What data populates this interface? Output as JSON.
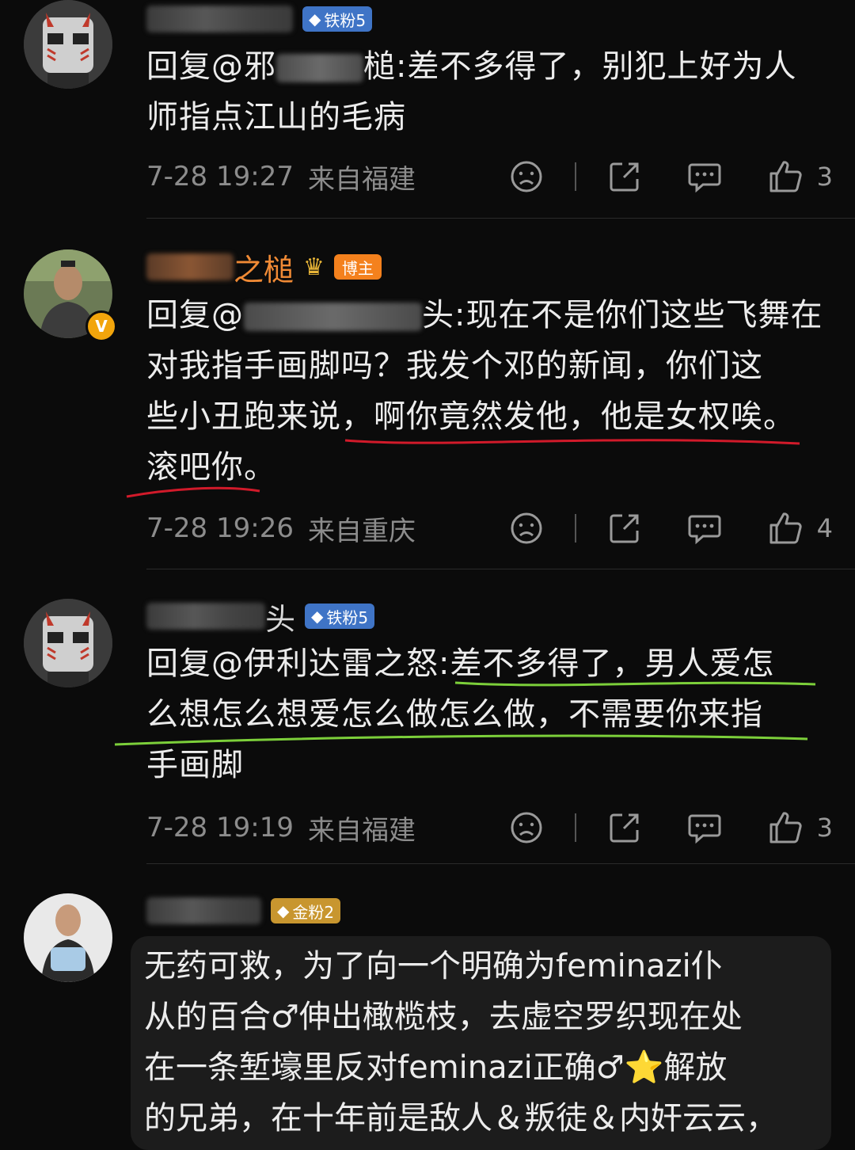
{
  "comments": [
    {
      "badge": "铁粉5",
      "reply_prefix": "回复@邪",
      "reply_rest": "槌:差不多得了，别犯上好为人",
      "line2": "师指点江山的毛病",
      "time": "7-28 19:27",
      "location": "来自福建",
      "likes": "3"
    },
    {
      "name_visible": "之槌",
      "badge": "博主",
      "reply_prefix": "回复@",
      "line1_rest": "头:现在不是你们这些飞舞在",
      "line2": "对我指手画脚吗？我发个邓的新闻，你们这",
      "line3": "些小丑跑来说，啊你竟然发他，他是女权唉。",
      "line4": "滚吧你。",
      "time": "7-28 19:26",
      "location": "来自重庆",
      "likes": "4"
    },
    {
      "name_tail": "头",
      "badge": "铁粉5",
      "line1": "回复@伊利达雷之怒:差不多得了，男人爱怎",
      "line2": "么想怎么想爱怎么做怎么做，不需要你来指",
      "line3": "手画脚",
      "time": "7-28 19:19",
      "location": "来自福建",
      "likes": "3"
    },
    {
      "badge": "金粉2",
      "line1": "无药可救，为了向一个明确为feminazi仆",
      "line2": "从的百合♂伸出橄榄枝，去虚空罗织现在处",
      "line3": "在一条堑壕里反对feminazi正确♂⭐解放",
      "line4": "的兄弟，在十年前是敌人＆叛徒＆内奸云云，"
    }
  ],
  "colors": {
    "background": "#0b0b0b",
    "text": "#ececec",
    "meta": "#8c8c8c",
    "name_orange": "#f08a35",
    "underline_red": "#d11a2a",
    "underline_green": "#7ccf3a"
  }
}
